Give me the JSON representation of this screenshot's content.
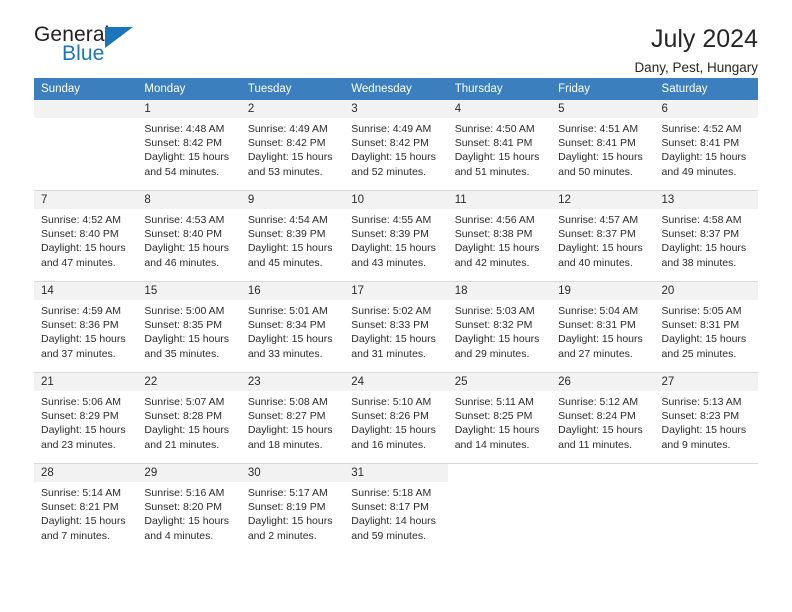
{
  "logo": {
    "word1": "General",
    "word2": "Blue",
    "flag_icon": "triangle-flag-icon",
    "brand_color": "#1b75bb"
  },
  "header": {
    "title": "July 2024",
    "subtitle": "Dany, Pest, Hungary"
  },
  "colors": {
    "header_row": "#3b7fbe",
    "daynum_band": "#f2f2f2",
    "grid_line": "#d9d9d9",
    "text": "#2b2b2b"
  },
  "calendar": {
    "weekday_headers": [
      "Sunday",
      "Monday",
      "Tuesday",
      "Wednesday",
      "Thursday",
      "Friday",
      "Saturday"
    ],
    "weeks": [
      [
        {
          "day": "",
          "sunrise": "",
          "sunset": "",
          "daylight1": "",
          "daylight2": ""
        },
        {
          "day": "1",
          "sunrise": "Sunrise: 4:48 AM",
          "sunset": "Sunset: 8:42 PM",
          "daylight1": "Daylight: 15 hours",
          "daylight2": "and 54 minutes."
        },
        {
          "day": "2",
          "sunrise": "Sunrise: 4:49 AM",
          "sunset": "Sunset: 8:42 PM",
          "daylight1": "Daylight: 15 hours",
          "daylight2": "and 53 minutes."
        },
        {
          "day": "3",
          "sunrise": "Sunrise: 4:49 AM",
          "sunset": "Sunset: 8:42 PM",
          "daylight1": "Daylight: 15 hours",
          "daylight2": "and 52 minutes."
        },
        {
          "day": "4",
          "sunrise": "Sunrise: 4:50 AM",
          "sunset": "Sunset: 8:41 PM",
          "daylight1": "Daylight: 15 hours",
          "daylight2": "and 51 minutes."
        },
        {
          "day": "5",
          "sunrise": "Sunrise: 4:51 AM",
          "sunset": "Sunset: 8:41 PM",
          "daylight1": "Daylight: 15 hours",
          "daylight2": "and 50 minutes."
        },
        {
          "day": "6",
          "sunrise": "Sunrise: 4:52 AM",
          "sunset": "Sunset: 8:41 PM",
          "daylight1": "Daylight: 15 hours",
          "daylight2": "and 49 minutes."
        }
      ],
      [
        {
          "day": "7",
          "sunrise": "Sunrise: 4:52 AM",
          "sunset": "Sunset: 8:40 PM",
          "daylight1": "Daylight: 15 hours",
          "daylight2": "and 47 minutes."
        },
        {
          "day": "8",
          "sunrise": "Sunrise: 4:53 AM",
          "sunset": "Sunset: 8:40 PM",
          "daylight1": "Daylight: 15 hours",
          "daylight2": "and 46 minutes."
        },
        {
          "day": "9",
          "sunrise": "Sunrise: 4:54 AM",
          "sunset": "Sunset: 8:39 PM",
          "daylight1": "Daylight: 15 hours",
          "daylight2": "and 45 minutes."
        },
        {
          "day": "10",
          "sunrise": "Sunrise: 4:55 AM",
          "sunset": "Sunset: 8:39 PM",
          "daylight1": "Daylight: 15 hours",
          "daylight2": "and 43 minutes."
        },
        {
          "day": "11",
          "sunrise": "Sunrise: 4:56 AM",
          "sunset": "Sunset: 8:38 PM",
          "daylight1": "Daylight: 15 hours",
          "daylight2": "and 42 minutes."
        },
        {
          "day": "12",
          "sunrise": "Sunrise: 4:57 AM",
          "sunset": "Sunset: 8:37 PM",
          "daylight1": "Daylight: 15 hours",
          "daylight2": "and 40 minutes."
        },
        {
          "day": "13",
          "sunrise": "Sunrise: 4:58 AM",
          "sunset": "Sunset: 8:37 PM",
          "daylight1": "Daylight: 15 hours",
          "daylight2": "and 38 minutes."
        }
      ],
      [
        {
          "day": "14",
          "sunrise": "Sunrise: 4:59 AM",
          "sunset": "Sunset: 8:36 PM",
          "daylight1": "Daylight: 15 hours",
          "daylight2": "and 37 minutes."
        },
        {
          "day": "15",
          "sunrise": "Sunrise: 5:00 AM",
          "sunset": "Sunset: 8:35 PM",
          "daylight1": "Daylight: 15 hours",
          "daylight2": "and 35 minutes."
        },
        {
          "day": "16",
          "sunrise": "Sunrise: 5:01 AM",
          "sunset": "Sunset: 8:34 PM",
          "daylight1": "Daylight: 15 hours",
          "daylight2": "and 33 minutes."
        },
        {
          "day": "17",
          "sunrise": "Sunrise: 5:02 AM",
          "sunset": "Sunset: 8:33 PM",
          "daylight1": "Daylight: 15 hours",
          "daylight2": "and 31 minutes."
        },
        {
          "day": "18",
          "sunrise": "Sunrise: 5:03 AM",
          "sunset": "Sunset: 8:32 PM",
          "daylight1": "Daylight: 15 hours",
          "daylight2": "and 29 minutes."
        },
        {
          "day": "19",
          "sunrise": "Sunrise: 5:04 AM",
          "sunset": "Sunset: 8:31 PM",
          "daylight1": "Daylight: 15 hours",
          "daylight2": "and 27 minutes."
        },
        {
          "day": "20",
          "sunrise": "Sunrise: 5:05 AM",
          "sunset": "Sunset: 8:31 PM",
          "daylight1": "Daylight: 15 hours",
          "daylight2": "and 25 minutes."
        }
      ],
      [
        {
          "day": "21",
          "sunrise": "Sunrise: 5:06 AM",
          "sunset": "Sunset: 8:29 PM",
          "daylight1": "Daylight: 15 hours",
          "daylight2": "and 23 minutes."
        },
        {
          "day": "22",
          "sunrise": "Sunrise: 5:07 AM",
          "sunset": "Sunset: 8:28 PM",
          "daylight1": "Daylight: 15 hours",
          "daylight2": "and 21 minutes."
        },
        {
          "day": "23",
          "sunrise": "Sunrise: 5:08 AM",
          "sunset": "Sunset: 8:27 PM",
          "daylight1": "Daylight: 15 hours",
          "daylight2": "and 18 minutes."
        },
        {
          "day": "24",
          "sunrise": "Sunrise: 5:10 AM",
          "sunset": "Sunset: 8:26 PM",
          "daylight1": "Daylight: 15 hours",
          "daylight2": "and 16 minutes."
        },
        {
          "day": "25",
          "sunrise": "Sunrise: 5:11 AM",
          "sunset": "Sunset: 8:25 PM",
          "daylight1": "Daylight: 15 hours",
          "daylight2": "and 14 minutes."
        },
        {
          "day": "26",
          "sunrise": "Sunrise: 5:12 AM",
          "sunset": "Sunset: 8:24 PM",
          "daylight1": "Daylight: 15 hours",
          "daylight2": "and 11 minutes."
        },
        {
          "day": "27",
          "sunrise": "Sunrise: 5:13 AM",
          "sunset": "Sunset: 8:23 PM",
          "daylight1": "Daylight: 15 hours",
          "daylight2": "and 9 minutes."
        }
      ],
      [
        {
          "day": "28",
          "sunrise": "Sunrise: 5:14 AM",
          "sunset": "Sunset: 8:21 PM",
          "daylight1": "Daylight: 15 hours",
          "daylight2": "and 7 minutes."
        },
        {
          "day": "29",
          "sunrise": "Sunrise: 5:16 AM",
          "sunset": "Sunset: 8:20 PM",
          "daylight1": "Daylight: 15 hours",
          "daylight2": "and 4 minutes."
        },
        {
          "day": "30",
          "sunrise": "Sunrise: 5:17 AM",
          "sunset": "Sunset: 8:19 PM",
          "daylight1": "Daylight: 15 hours",
          "daylight2": "and 2 minutes."
        },
        {
          "day": "31",
          "sunrise": "Sunrise: 5:18 AM",
          "sunset": "Sunset: 8:17 PM",
          "daylight1": "Daylight: 14 hours",
          "daylight2": "and 59 minutes."
        },
        {
          "day": "",
          "sunrise": "",
          "sunset": "",
          "daylight1": "",
          "daylight2": ""
        },
        {
          "day": "",
          "sunrise": "",
          "sunset": "",
          "daylight1": "",
          "daylight2": ""
        },
        {
          "day": "",
          "sunrise": "",
          "sunset": "",
          "daylight1": "",
          "daylight2": ""
        }
      ]
    ]
  }
}
